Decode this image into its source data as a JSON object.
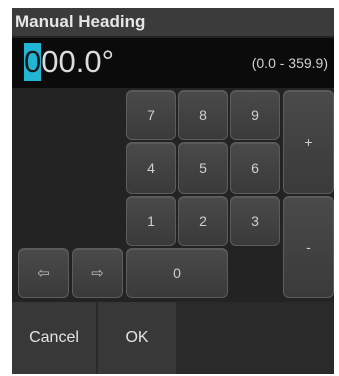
{
  "dialog": {
    "title": "Manual Heading",
    "value_cursor_char": "0",
    "value_rest": "00.0°",
    "range": "(0.0 - 359.9)"
  },
  "keypad": {
    "k7": "7",
    "k8": "8",
    "k9": "9",
    "k4": "4",
    "k5": "5",
    "k6": "6",
    "k1": "1",
    "k2": "2",
    "k3": "3",
    "k0": "0",
    "plus": "+",
    "minus": "-",
    "left_arrow": "⇦",
    "right_arrow": "⇨"
  },
  "actions": {
    "cancel": "Cancel",
    "ok": "OK"
  },
  "icons": {
    "left": "left-arrow-icon",
    "right": "right-arrow-icon"
  },
  "colors": {
    "accent_cursor": "#22b6d4",
    "dialog_bg": "#232323",
    "display_bg": "#0b0b0b"
  }
}
